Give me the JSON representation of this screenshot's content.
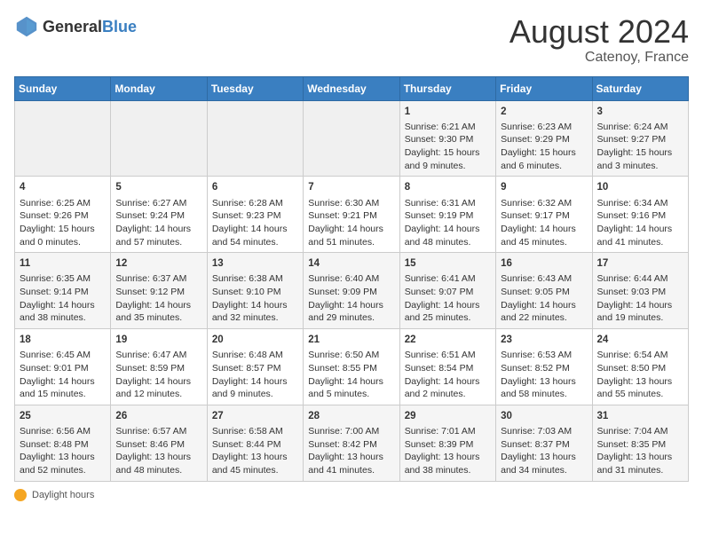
{
  "header": {
    "logo_general": "General",
    "logo_blue": "Blue",
    "title": "August 2024",
    "subtitle": "Catenoy, France"
  },
  "weekdays": [
    "Sunday",
    "Monday",
    "Tuesday",
    "Wednesday",
    "Thursday",
    "Friday",
    "Saturday"
  ],
  "footer": {
    "daylight_label": "Daylight hours"
  },
  "weeks": [
    [
      {
        "num": "",
        "data": ""
      },
      {
        "num": "",
        "data": ""
      },
      {
        "num": "",
        "data": ""
      },
      {
        "num": "",
        "data": ""
      },
      {
        "num": "1",
        "data": "Sunrise: 6:21 AM\nSunset: 9:30 PM\nDaylight: 15 hours and 9 minutes."
      },
      {
        "num": "2",
        "data": "Sunrise: 6:23 AM\nSunset: 9:29 PM\nDaylight: 15 hours and 6 minutes."
      },
      {
        "num": "3",
        "data": "Sunrise: 6:24 AM\nSunset: 9:27 PM\nDaylight: 15 hours and 3 minutes."
      }
    ],
    [
      {
        "num": "4",
        "data": "Sunrise: 6:25 AM\nSunset: 9:26 PM\nDaylight: 15 hours and 0 minutes."
      },
      {
        "num": "5",
        "data": "Sunrise: 6:27 AM\nSunset: 9:24 PM\nDaylight: 14 hours and 57 minutes."
      },
      {
        "num": "6",
        "data": "Sunrise: 6:28 AM\nSunset: 9:23 PM\nDaylight: 14 hours and 54 minutes."
      },
      {
        "num": "7",
        "data": "Sunrise: 6:30 AM\nSunset: 9:21 PM\nDaylight: 14 hours and 51 minutes."
      },
      {
        "num": "8",
        "data": "Sunrise: 6:31 AM\nSunset: 9:19 PM\nDaylight: 14 hours and 48 minutes."
      },
      {
        "num": "9",
        "data": "Sunrise: 6:32 AM\nSunset: 9:17 PM\nDaylight: 14 hours and 45 minutes."
      },
      {
        "num": "10",
        "data": "Sunrise: 6:34 AM\nSunset: 9:16 PM\nDaylight: 14 hours and 41 minutes."
      }
    ],
    [
      {
        "num": "11",
        "data": "Sunrise: 6:35 AM\nSunset: 9:14 PM\nDaylight: 14 hours and 38 minutes."
      },
      {
        "num": "12",
        "data": "Sunrise: 6:37 AM\nSunset: 9:12 PM\nDaylight: 14 hours and 35 minutes."
      },
      {
        "num": "13",
        "data": "Sunrise: 6:38 AM\nSunset: 9:10 PM\nDaylight: 14 hours and 32 minutes."
      },
      {
        "num": "14",
        "data": "Sunrise: 6:40 AM\nSunset: 9:09 PM\nDaylight: 14 hours and 29 minutes."
      },
      {
        "num": "15",
        "data": "Sunrise: 6:41 AM\nSunset: 9:07 PM\nDaylight: 14 hours and 25 minutes."
      },
      {
        "num": "16",
        "data": "Sunrise: 6:43 AM\nSunset: 9:05 PM\nDaylight: 14 hours and 22 minutes."
      },
      {
        "num": "17",
        "data": "Sunrise: 6:44 AM\nSunset: 9:03 PM\nDaylight: 14 hours and 19 minutes."
      }
    ],
    [
      {
        "num": "18",
        "data": "Sunrise: 6:45 AM\nSunset: 9:01 PM\nDaylight: 14 hours and 15 minutes."
      },
      {
        "num": "19",
        "data": "Sunrise: 6:47 AM\nSunset: 8:59 PM\nDaylight: 14 hours and 12 minutes."
      },
      {
        "num": "20",
        "data": "Sunrise: 6:48 AM\nSunset: 8:57 PM\nDaylight: 14 hours and 9 minutes."
      },
      {
        "num": "21",
        "data": "Sunrise: 6:50 AM\nSunset: 8:55 PM\nDaylight: 14 hours and 5 minutes."
      },
      {
        "num": "22",
        "data": "Sunrise: 6:51 AM\nSunset: 8:54 PM\nDaylight: 14 hours and 2 minutes."
      },
      {
        "num": "23",
        "data": "Sunrise: 6:53 AM\nSunset: 8:52 PM\nDaylight: 13 hours and 58 minutes."
      },
      {
        "num": "24",
        "data": "Sunrise: 6:54 AM\nSunset: 8:50 PM\nDaylight: 13 hours and 55 minutes."
      }
    ],
    [
      {
        "num": "25",
        "data": "Sunrise: 6:56 AM\nSunset: 8:48 PM\nDaylight: 13 hours and 52 minutes."
      },
      {
        "num": "26",
        "data": "Sunrise: 6:57 AM\nSunset: 8:46 PM\nDaylight: 13 hours and 48 minutes."
      },
      {
        "num": "27",
        "data": "Sunrise: 6:58 AM\nSunset: 8:44 PM\nDaylight: 13 hours and 45 minutes."
      },
      {
        "num": "28",
        "data": "Sunrise: 7:00 AM\nSunset: 8:42 PM\nDaylight: 13 hours and 41 minutes."
      },
      {
        "num": "29",
        "data": "Sunrise: 7:01 AM\nSunset: 8:39 PM\nDaylight: 13 hours and 38 minutes."
      },
      {
        "num": "30",
        "data": "Sunrise: 7:03 AM\nSunset: 8:37 PM\nDaylight: 13 hours and 34 minutes."
      },
      {
        "num": "31",
        "data": "Sunrise: 7:04 AM\nSunset: 8:35 PM\nDaylight: 13 hours and 31 minutes."
      }
    ]
  ]
}
